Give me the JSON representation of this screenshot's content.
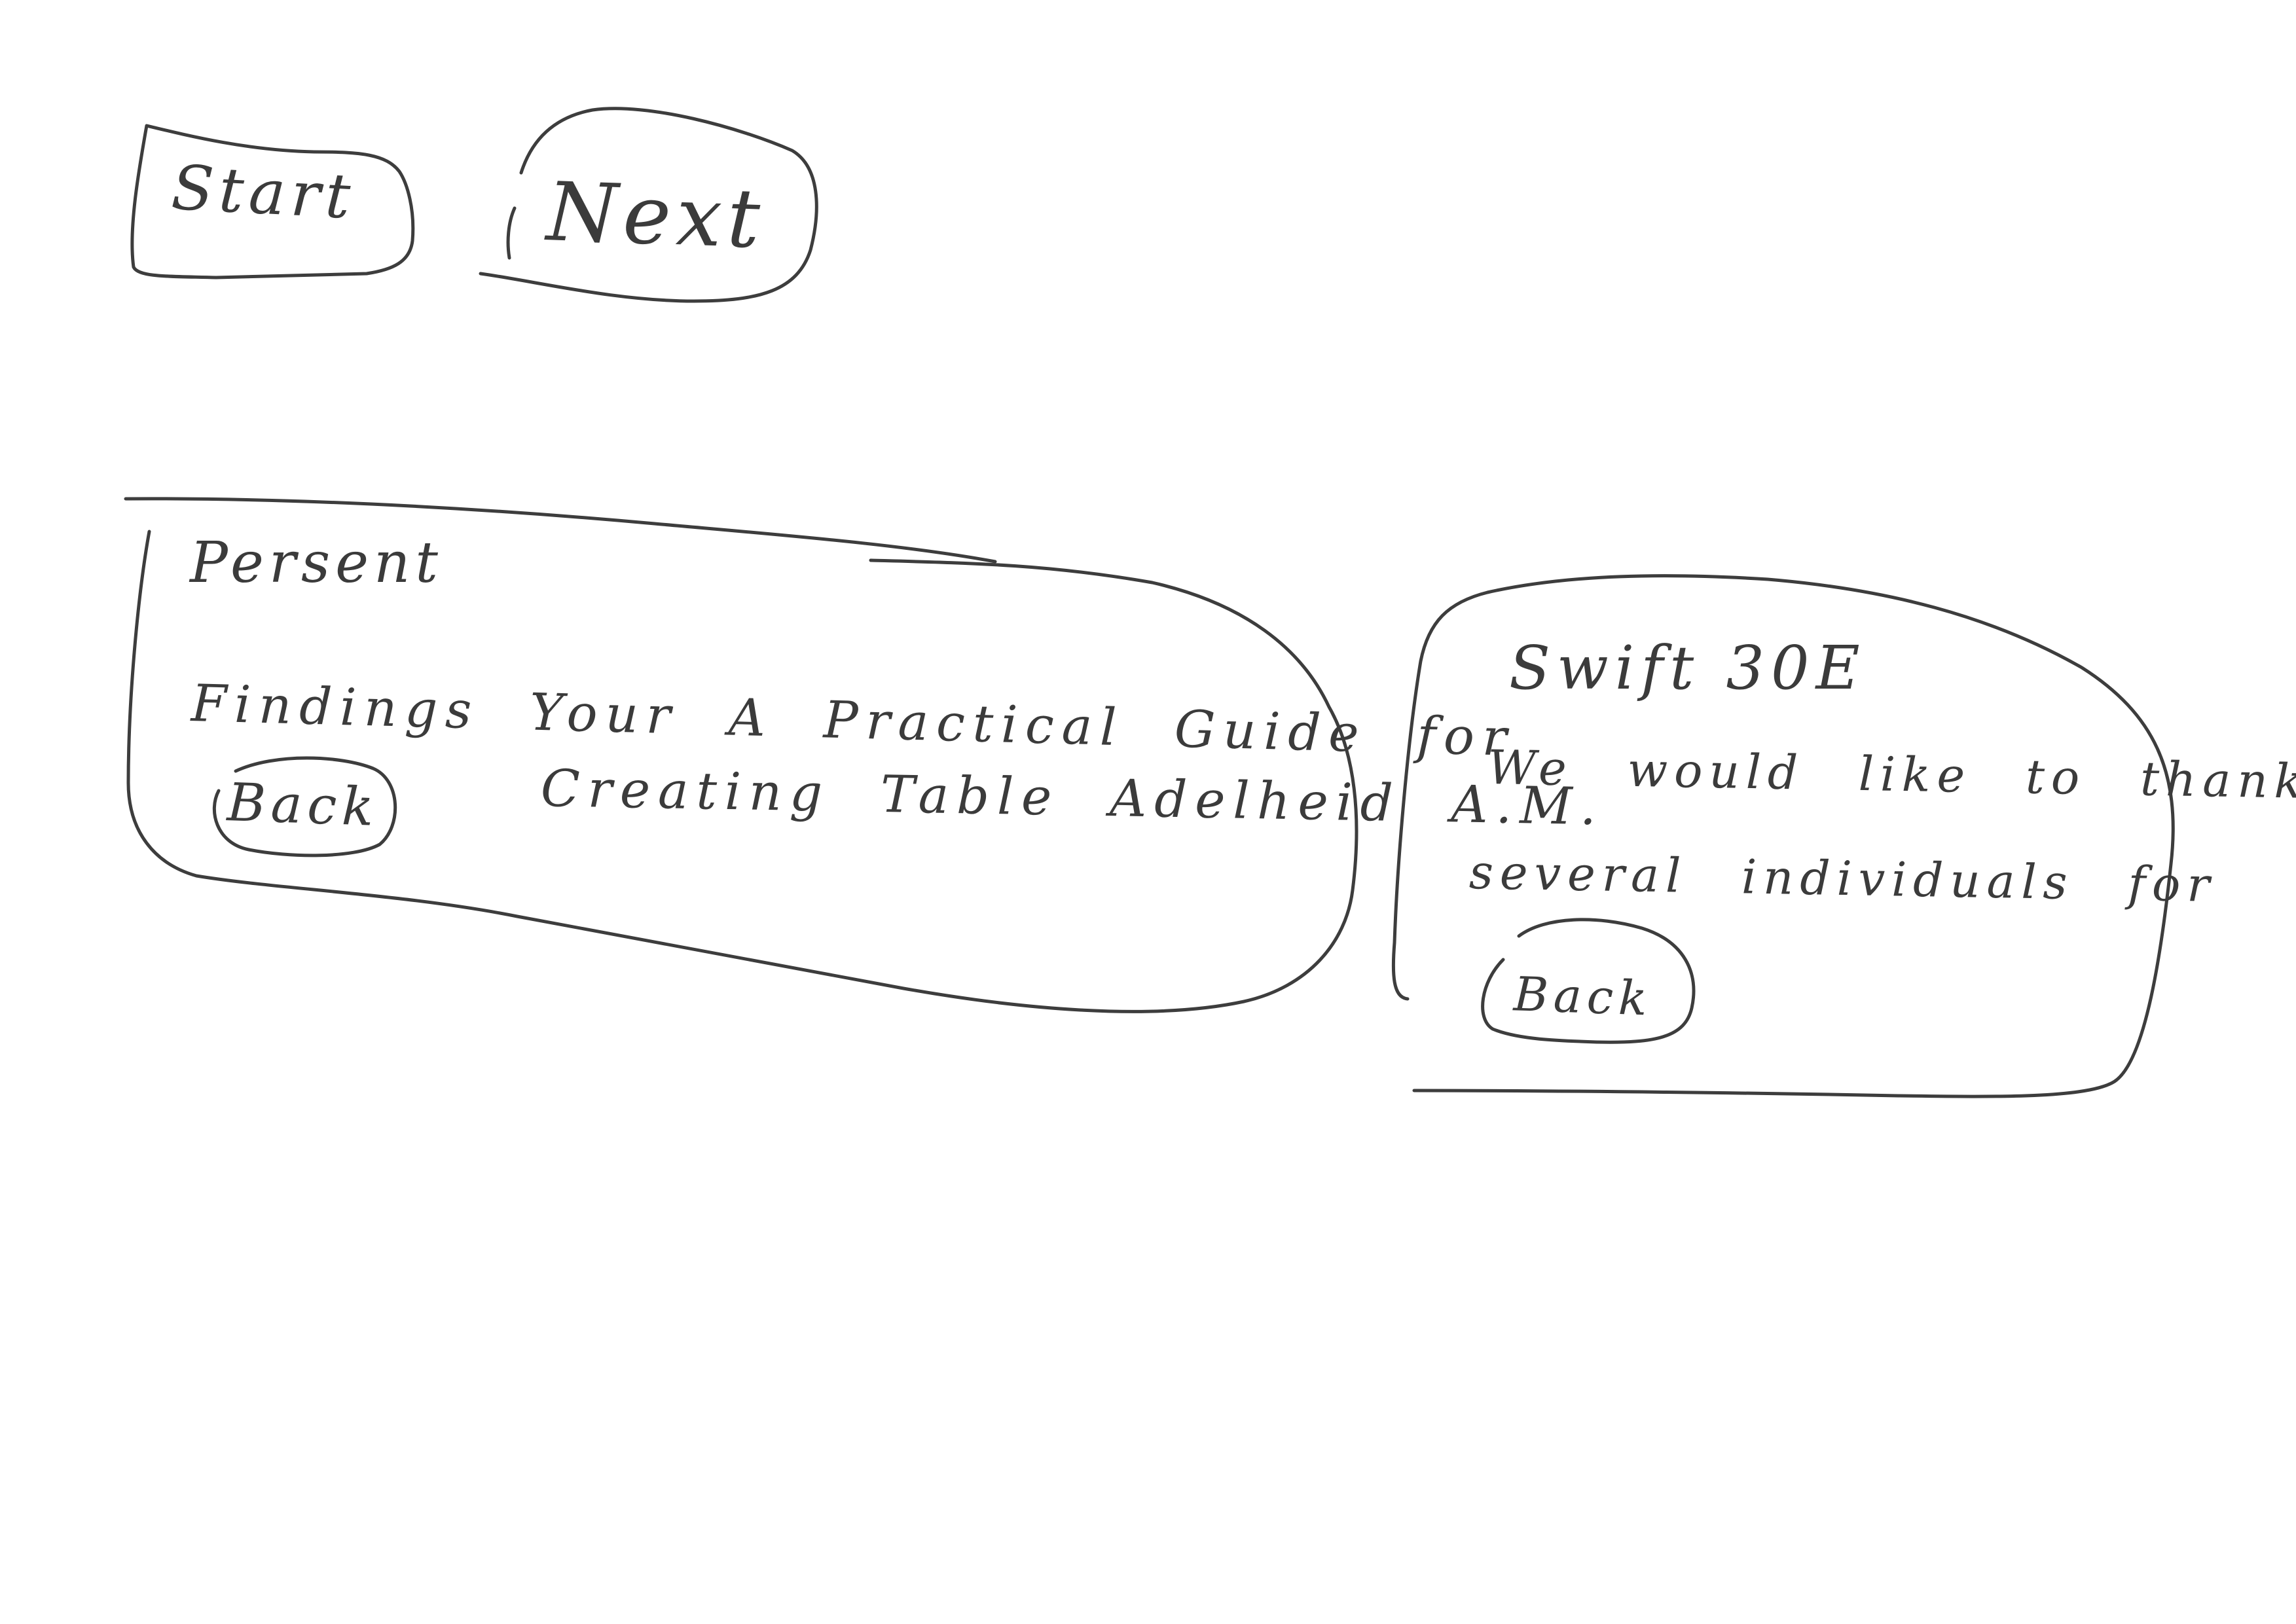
{
  "toolbar": {
    "start_label": "Start",
    "next_label": "Next"
  },
  "card_left": {
    "heading": "Persent",
    "line1": "Findings Your A Practical Guide for",
    "line2": "Creating Table Adelheid A.M.",
    "back_label": "Back"
  },
  "card_right": {
    "heading": "Swift 30E",
    "line1": "We would like to thank",
    "line2": "several individuals for",
    "back_label": "Back"
  }
}
